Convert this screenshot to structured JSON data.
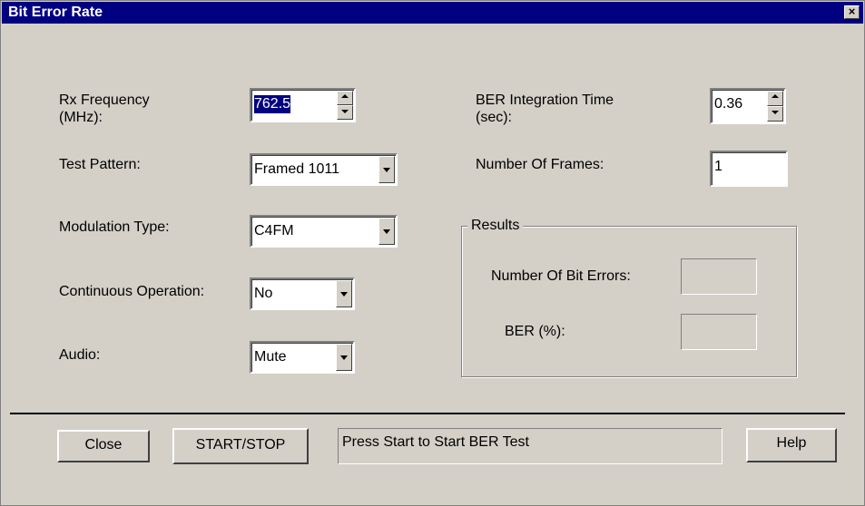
{
  "window": {
    "title": "Bit Error Rate",
    "close_glyph": "×"
  },
  "form": {
    "rx_frequency": {
      "label_line1": "Rx Frequency",
      "label_line2": "(MHz):",
      "value": "762.5"
    },
    "test_pattern": {
      "label": "Test Pattern:",
      "value": "Framed 1011"
    },
    "modulation_type": {
      "label": "Modulation Type:",
      "value": "C4FM"
    },
    "continuous_operation": {
      "label": "Continuous Operation:",
      "value": "No"
    },
    "audio": {
      "label": "Audio:",
      "value": "Mute"
    },
    "ber_integration_time": {
      "label_line1": "BER Integration Time",
      "label_line2": "(sec):",
      "value": "0.36"
    },
    "number_of_frames": {
      "label": "Number Of Frames:",
      "value": "1"
    }
  },
  "results": {
    "title": "Results",
    "bit_errors_label": "Number Of Bit Errors:",
    "bit_errors_value": "",
    "ber_label": "BER (%):",
    "ber_value": ""
  },
  "footer": {
    "close_label": "Close",
    "start_stop_label": "START/STOP",
    "status_text": "Press Start to Start BER Test",
    "help_label": "Help"
  },
  "colors": {
    "title_bar": "#000080",
    "dialog_face": "#d4d0c8",
    "selection": "#000080"
  }
}
